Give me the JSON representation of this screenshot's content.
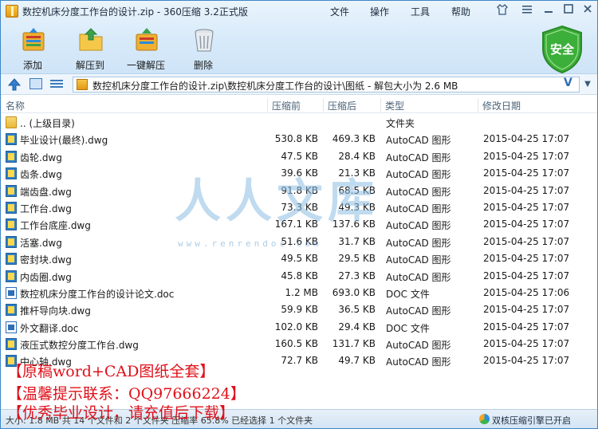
{
  "window": {
    "title": "数控机床分度工作台的设计.zip - 360压缩 3.2正式版"
  },
  "menu": {
    "file": "文件",
    "operation": "操作",
    "tools": "工具",
    "help": "帮助"
  },
  "toolbar": {
    "add": "添加",
    "extract_to": "解压到",
    "one_click_extract": "一键解压",
    "delete": "删除"
  },
  "security_badge": "安全",
  "address_bar": {
    "path": "数控机床分度工作台的设计.zip\\数控机床分度工作台的设计\\图纸 - 解包大小为 2.6 MB",
    "v_label": "V"
  },
  "columns": {
    "name": "名称",
    "size": "压缩前",
    "compressed": "压缩后",
    "type": "类型",
    "modified": "修改日期"
  },
  "files": [
    {
      "name": ".. (上级目录)",
      "size": "",
      "compressed": "",
      "type": "文件夹",
      "modified": "",
      "icon": "folder"
    },
    {
      "name": "毕业设计(最终).dwg",
      "size": "530.8 KB",
      "compressed": "469.3 KB",
      "type": "AutoCAD 图形",
      "modified": "2015-04-25 17:07",
      "icon": "dwg"
    },
    {
      "name": "齿轮.dwg",
      "size": "47.5 KB",
      "compressed": "28.4 KB",
      "type": "AutoCAD 图形",
      "modified": "2015-04-25 17:07",
      "icon": "dwg"
    },
    {
      "name": "齿条.dwg",
      "size": "39.6 KB",
      "compressed": "21.3 KB",
      "type": "AutoCAD 图形",
      "modified": "2015-04-25 17:07",
      "icon": "dwg"
    },
    {
      "name": "端齿盘.dwg",
      "size": "91.8 KB",
      "compressed": "68.5 KB",
      "type": "AutoCAD 图形",
      "modified": "2015-04-25 17:07",
      "icon": "dwg"
    },
    {
      "name": "工作台.dwg",
      "size": "73.3 KB",
      "compressed": "49.3 KB",
      "type": "AutoCAD 图形",
      "modified": "2015-04-25 17:07",
      "icon": "dwg"
    },
    {
      "name": "工作台底座.dwg",
      "size": "167.1 KB",
      "compressed": "137.6 KB",
      "type": "AutoCAD 图形",
      "modified": "2015-04-25 17:07",
      "icon": "dwg"
    },
    {
      "name": "活塞.dwg",
      "size": "51.6 KB",
      "compressed": "31.7 KB",
      "type": "AutoCAD 图形",
      "modified": "2015-04-25 17:07",
      "icon": "dwg"
    },
    {
      "name": "密封块.dwg",
      "size": "49.5 KB",
      "compressed": "29.5 KB",
      "type": "AutoCAD 图形",
      "modified": "2015-04-25 17:07",
      "icon": "dwg"
    },
    {
      "name": "内齿圈.dwg",
      "size": "45.8 KB",
      "compressed": "27.3 KB",
      "type": "AutoCAD 图形",
      "modified": "2015-04-25 17:07",
      "icon": "dwg"
    },
    {
      "name": "数控机床分度工作台的设计论文.doc",
      "size": "1.2 MB",
      "compressed": "693.0 KB",
      "type": "DOC 文件",
      "modified": "2015-04-25 17:06",
      "icon": "doc"
    },
    {
      "name": "推杆导向块.dwg",
      "size": "59.9 KB",
      "compressed": "36.5 KB",
      "type": "AutoCAD 图形",
      "modified": "2015-04-25 17:07",
      "icon": "dwg"
    },
    {
      "name": "外文翻译.doc",
      "size": "102.0 KB",
      "compressed": "29.4 KB",
      "type": "DOC 文件",
      "modified": "2015-04-25 17:07",
      "icon": "doc"
    },
    {
      "name": "液压式数控分度工作台.dwg",
      "size": "160.5 KB",
      "compressed": "131.7 KB",
      "type": "AutoCAD 图形",
      "modified": "2015-04-25 17:07",
      "icon": "dwg"
    },
    {
      "name": "中心轴.dwg",
      "size": "72.7 KB",
      "compressed": "49.7 KB",
      "type": "AutoCAD 图形",
      "modified": "2015-04-25 17:07",
      "icon": "dwg"
    }
  ],
  "watermark": {
    "text": "人人文库",
    "url": "www.renrendoc.com"
  },
  "promo": {
    "line1": "【原稿word+CAD图纸全套】",
    "line2": "【温馨提示联系：QQ97666224】",
    "line3": "【优秀毕业设计，请充值后下载】"
  },
  "status_bar": {
    "left": "大小: 1.8 MB 共 14 个文件和 2 个文件夹 压缩率 65.8% 已经选择 1 个文件夹",
    "right": "双核压缩引擎已开启"
  }
}
